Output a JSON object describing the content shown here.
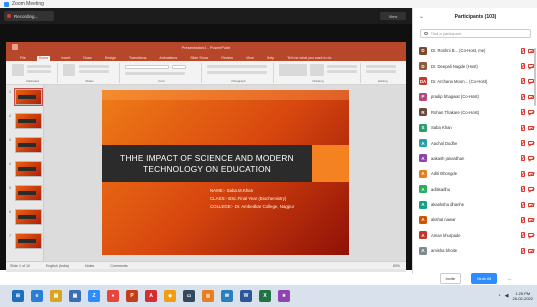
{
  "window": {
    "title": "Zoom Meeting"
  },
  "meeting": {
    "recording_label": "Recording...",
    "view_label": "View"
  },
  "ppt": {
    "title": "Presentation1 - PowerPoint",
    "tabs": [
      "File",
      "Home",
      "Insert",
      "Draw",
      "Design",
      "Transitions",
      "Animations",
      "Slide Show",
      "Review",
      "View",
      "Help",
      "Tell me what you want to do"
    ],
    "ribbon_groups": [
      "Clipboard",
      "Slides",
      "Font",
      "Paragraph",
      "Drawing",
      "Editing"
    ],
    "status": {
      "slide": "Slide 1 of 10",
      "language": "English (India)",
      "notes": "Notes",
      "comments": "Comments",
      "zoom": "83%"
    }
  },
  "slide": {
    "title_line1": "THHE IMPACT OF SCIENCE AND MODERN",
    "title_line2": "TECHNOLOGY ON EDUCATION",
    "name": "NAME:- Saba.M.Khan",
    "class": "CLASS:- BSc.Final Year (Biochemistry)",
    "college": "COLLEGE:- Dr. Ambedkar College, Nagpur"
  },
  "thumbnails": [
    "1",
    "2",
    "3",
    "4",
    "5",
    "6",
    "7"
  ],
  "participants_panel": {
    "title": "Participants (103)",
    "search_placeholder": "Find a participant",
    "participants": [
      {
        "name": "Dr. Roshni B... (Co-Host, me)",
        "initial": "D",
        "color": "#7a4a2e"
      },
      {
        "name": "Dr. Deepali Nagde (Host)",
        "initial": "D",
        "color": "#8c5c3c"
      },
      {
        "name": "Dr. Archana Moon... (Co-Host)",
        "initial": "DA",
        "color": "#c0392b"
      },
      {
        "name": "pradip bhagwat (Co-Host)",
        "initial": "P",
        "color": "#b34a7a"
      },
      {
        "name": "Rohan Thakare (Co-Host)",
        "initial": "R",
        "color": "#6a4a3a"
      },
      {
        "name": "Saba Khan",
        "initial": "S",
        "color": "#2f9e6e"
      },
      {
        "name": "Aachal Dudhe",
        "initial": "A",
        "color": "#2aa1a8"
      },
      {
        "name": "aakash janardhan",
        "initial": "A",
        "color": "#8e44ad"
      },
      {
        "name": "Aditi Bhongde",
        "initial": "A",
        "color": "#e67e22"
      },
      {
        "name": "aditisadhu",
        "initial": "A",
        "color": "#27ae60"
      },
      {
        "name": "akanksha dhanhe",
        "initial": "A",
        "color": "#16a085"
      },
      {
        "name": "akshal nawar",
        "initial": "A",
        "color": "#d35400"
      },
      {
        "name": "Aman khurpade",
        "initial": "A",
        "color": "#c0392b"
      },
      {
        "name": "amisha bhoite",
        "initial": "A",
        "color": "#7f8c8d"
      }
    ],
    "invite_label": "Invite",
    "mute_all_label": "Mute All",
    "more_label": "..."
  },
  "taskbar": {
    "apps": [
      {
        "glyph": "⊞",
        "color": "#1f6fbf"
      },
      {
        "glyph": "e",
        "color": "#2a7fd4"
      },
      {
        "glyph": "▤",
        "color": "#d9a520"
      },
      {
        "glyph": "▣",
        "color": "#3a6fb5"
      },
      {
        "glyph": "Z",
        "color": "#2d8cff"
      },
      {
        "glyph": "●",
        "color": "#e8453c"
      },
      {
        "glyph": "P",
        "color": "#c43e1c"
      },
      {
        "glyph": "A",
        "color": "#d32f2f"
      },
      {
        "glyph": "◆",
        "color": "#f39c12"
      },
      {
        "glyph": "▭",
        "color": "#34495e"
      },
      {
        "glyph": "◎",
        "color": "#e67e22"
      },
      {
        "glyph": "✉",
        "color": "#2980b9"
      },
      {
        "glyph": "W",
        "color": "#2b579a"
      },
      {
        "glyph": "X",
        "color": "#217346"
      },
      {
        "glyph": "★",
        "color": "#8e44ad"
      }
    ],
    "time": "1:25 PM",
    "date": "26-02-2022"
  }
}
